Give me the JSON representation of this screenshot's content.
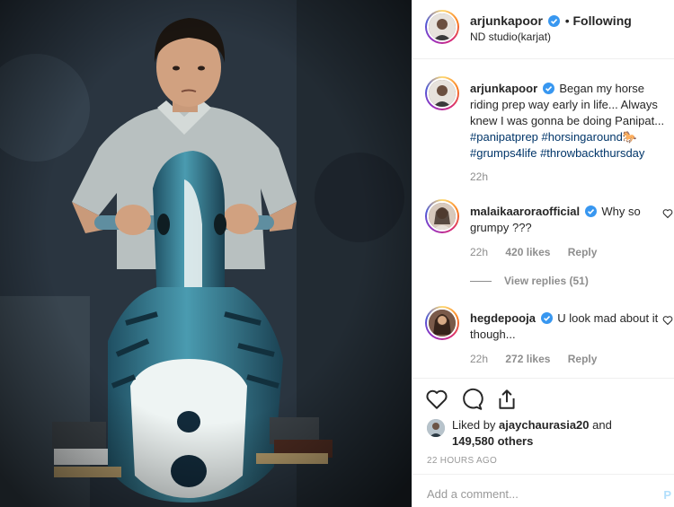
{
  "header": {
    "username": "arjunkapoor",
    "separator": "•",
    "follow_status": "Following",
    "location": "ND studio(karjat)"
  },
  "caption": {
    "username": "arjunkapoor",
    "text": "Began my horse riding prep way early in life... Always knew I was gonna be doing Panipat...",
    "hashtags": [
      "#panipatprep",
      "#horsingaround",
      "#grumps4life",
      "#throwbackthursday"
    ],
    "emoji": "🐎",
    "time": "22h"
  },
  "comments": [
    {
      "username": "malaikaaroraofficial",
      "text": "Why so grumpy ???",
      "time": "22h",
      "likes": "420 likes",
      "reply": "Reply",
      "view_replies": "View replies (51)"
    },
    {
      "username": "hegdepooja",
      "text": "U look mad about it though...",
      "time": "22h",
      "likes": "272 likes",
      "reply": "Reply"
    }
  ],
  "actions": {
    "liked_by_prefix": "Liked by",
    "liked_by_user": "ajaychaurasia20",
    "liked_by_and": "and",
    "liked_by_count": "149,580 others",
    "timestamp": "22 HOURS AGO"
  },
  "add_comment": {
    "placeholder": "Add a comment...",
    "post_label": "P"
  },
  "colors": {
    "verified": "#3897f0",
    "link": "#003569",
    "muted": "#8e8e8e"
  }
}
